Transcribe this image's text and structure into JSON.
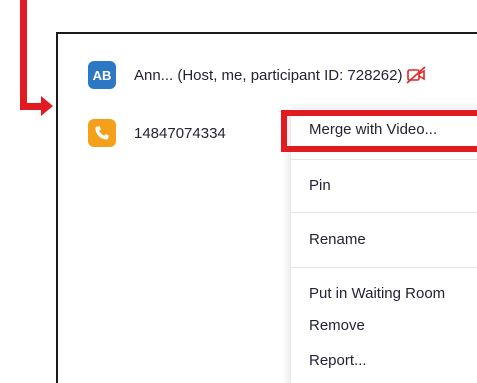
{
  "participants": [
    {
      "avatar_text": "AB",
      "avatar_color": "#2d78c4",
      "display": "Ann... (Host, me, participant ID: 728262)",
      "video_icon": "camera-off-icon"
    },
    {
      "avatar_icon": "phone-icon",
      "avatar_color": "#f5a01a",
      "display": "14847074334"
    }
  ],
  "context_menu": {
    "items": [
      "Merge with Video...",
      "Pin",
      "Rename",
      "Put in Waiting Room",
      "Remove",
      "Report..."
    ]
  },
  "annotation_color": "#e21b23"
}
